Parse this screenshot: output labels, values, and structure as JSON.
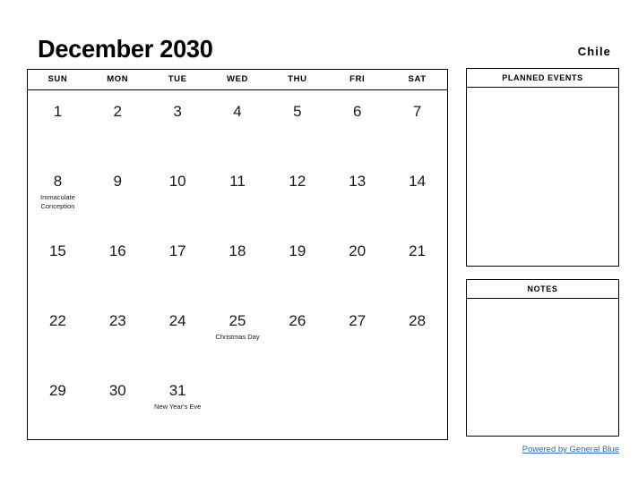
{
  "header": {
    "title": "December 2030",
    "country": "Chile"
  },
  "calendar": {
    "day_headers": [
      "SUN",
      "MON",
      "TUE",
      "WED",
      "THU",
      "FRI",
      "SAT"
    ],
    "weeks": [
      [
        {
          "day": "1",
          "event": ""
        },
        {
          "day": "2",
          "event": ""
        },
        {
          "day": "3",
          "event": ""
        },
        {
          "day": "4",
          "event": ""
        },
        {
          "day": "5",
          "event": ""
        },
        {
          "day": "6",
          "event": ""
        },
        {
          "day": "7",
          "event": ""
        }
      ],
      [
        {
          "day": "8",
          "event": "Immaculate Conception"
        },
        {
          "day": "9",
          "event": ""
        },
        {
          "day": "10",
          "event": ""
        },
        {
          "day": "11",
          "event": ""
        },
        {
          "day": "12",
          "event": ""
        },
        {
          "day": "13",
          "event": ""
        },
        {
          "day": "14",
          "event": ""
        }
      ],
      [
        {
          "day": "15",
          "event": ""
        },
        {
          "day": "16",
          "event": ""
        },
        {
          "day": "17",
          "event": ""
        },
        {
          "day": "18",
          "event": ""
        },
        {
          "day": "19",
          "event": ""
        },
        {
          "day": "20",
          "event": ""
        },
        {
          "day": "21",
          "event": ""
        }
      ],
      [
        {
          "day": "22",
          "event": ""
        },
        {
          "day": "23",
          "event": ""
        },
        {
          "day": "24",
          "event": ""
        },
        {
          "day": "25",
          "event": "Christmas Day"
        },
        {
          "day": "26",
          "event": ""
        },
        {
          "day": "27",
          "event": ""
        },
        {
          "day": "28",
          "event": ""
        }
      ],
      [
        {
          "day": "29",
          "event": ""
        },
        {
          "day": "30",
          "event": ""
        },
        {
          "day": "31",
          "event": "New Year's Eve"
        },
        {
          "day": "",
          "event": ""
        },
        {
          "day": "",
          "event": ""
        },
        {
          "day": "",
          "event": ""
        },
        {
          "day": "",
          "event": ""
        }
      ]
    ]
  },
  "side_panels": {
    "planned_events_title": "PLANNED EVENTS",
    "notes_title": "NOTES"
  },
  "footer": {
    "link_text": "Powered by General Blue",
    "link_color": "#2a6cb5"
  }
}
